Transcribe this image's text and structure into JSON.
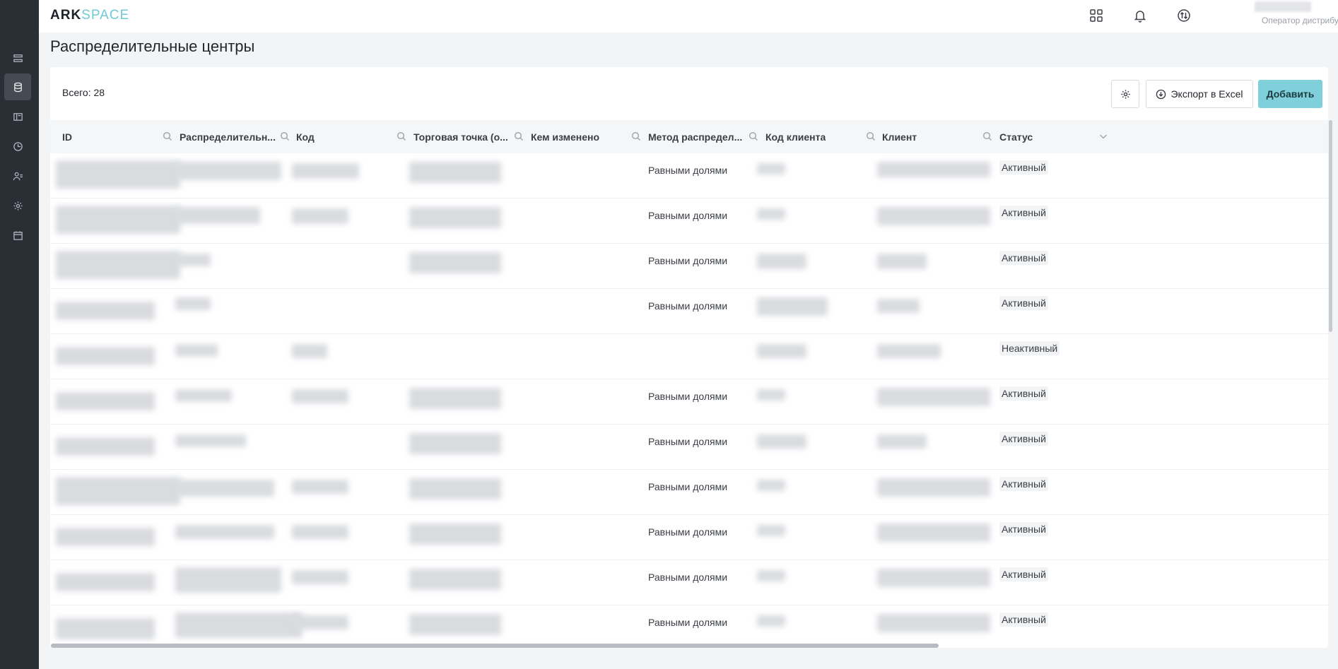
{
  "app": {
    "logo_bold": "ARK",
    "logo_light": "SPACE",
    "user_role": "Оператор дистрибу..."
  },
  "sidebar": {
    "items": [
      {
        "icon": "list-icon",
        "active": false
      },
      {
        "icon": "database-icon",
        "active": true
      },
      {
        "icon": "book-icon",
        "active": false
      },
      {
        "icon": "clock-icon",
        "active": false
      },
      {
        "icon": "users-icon",
        "active": false
      },
      {
        "icon": "gear-icon",
        "active": false
      },
      {
        "icon": "calendar-icon",
        "active": false
      }
    ]
  },
  "page": {
    "title": "Распределительные центры",
    "total_label": "Всего: 28",
    "export_label": "Экспорт в Excel",
    "add_label": "Добавить"
  },
  "table": {
    "columns": [
      "ID",
      "Распределительн...",
      "Код",
      "Торговая точка (о...",
      "Кем изменено",
      "Метод распредел...",
      "Код клиента",
      "Клиент",
      "Статус"
    ],
    "rows": [
      {
        "method": "Равными долями",
        "status": "Активный"
      },
      {
        "method": "Равными долями",
        "status": "Активный"
      },
      {
        "method": "Равными долями",
        "status": "Активный"
      },
      {
        "method": "Равными долями",
        "status": "Активный"
      },
      {
        "method": "",
        "status": "Неактивный"
      },
      {
        "method": "Равными долями",
        "status": "Активный"
      },
      {
        "method": "Равными долями",
        "status": "Активный"
      },
      {
        "method": "Равными долями",
        "status": "Активный"
      },
      {
        "method": "Равными долями",
        "status": "Активный"
      },
      {
        "method": "Равными долями",
        "status": "Активный"
      },
      {
        "method": "Равными долями",
        "status": "Активный"
      }
    ]
  },
  "colors": {
    "sidebar_bg": "#2a2e35",
    "accent": "#7fd0da",
    "logo_accent": "#6fcbd4"
  }
}
